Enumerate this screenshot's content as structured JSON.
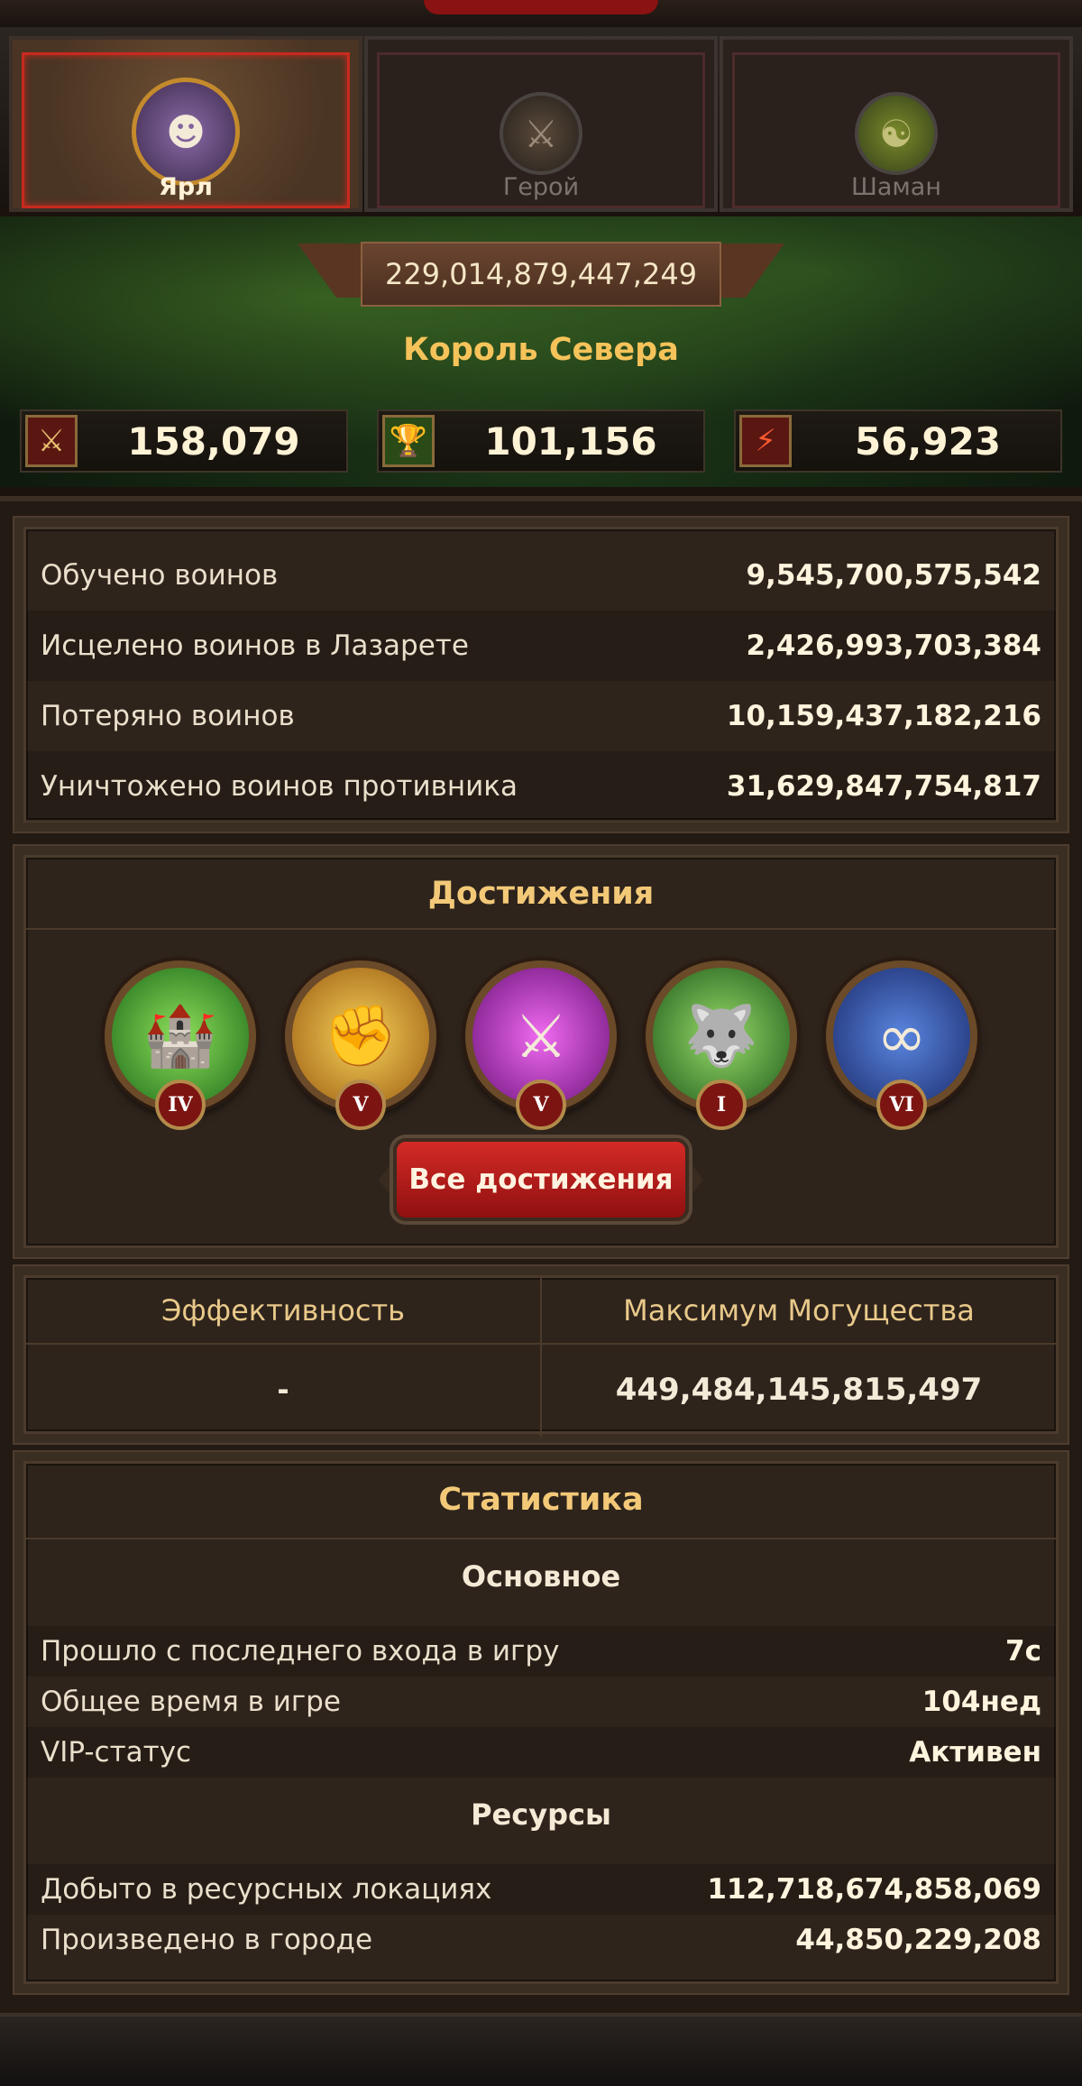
{
  "tabs": [
    {
      "label": "Ярл",
      "active": true,
      "icon": "hooded-jarl-avatar-icon"
    },
    {
      "label": "Герой",
      "active": false,
      "icon": "warrior-hero-avatar-icon"
    },
    {
      "label": "Шаман",
      "active": false,
      "icon": "shaman-avatar-icon"
    }
  ],
  "profile": {
    "power": "229,014,879,447,249",
    "title": "Король Севера",
    "stats": [
      {
        "icon": "crossed-swords-icon",
        "value": "158,079"
      },
      {
        "icon": "trophy-icon",
        "value": "101,156"
      },
      {
        "icon": "broken-shield-icon",
        "value": "56,923"
      }
    ]
  },
  "warriors": [
    {
      "label": "Обучено воинов",
      "value": "9,545,700,575,542"
    },
    {
      "label": "Исцелено воинов в Лазарете",
      "value": "2,426,993,703,384"
    },
    {
      "label": "Потеряно воинов",
      "value": "10,159,437,182,216"
    },
    {
      "label": "Уничтожено воинов противника",
      "value": "31,629,847,754,817"
    }
  ],
  "achievements": {
    "title": "Достижения",
    "items": [
      {
        "icon": "hand-building-tower-icon",
        "rank": "IV"
      },
      {
        "icon": "golden-fist-icon",
        "rank": "V"
      },
      {
        "icon": "helmet-crossed-weapons-icon",
        "rank": "V"
      },
      {
        "icon": "silver-wolf-head-icon",
        "rank": "I"
      },
      {
        "icon": "golden-rings-icon",
        "rank": "VI"
      }
    ],
    "button": "Все достижения"
  },
  "efficiency": {
    "left_header": "Эффективность",
    "right_header": "Максимум Могущества",
    "left_value": "-",
    "right_value": "449,484,145,815,497"
  },
  "statistics": {
    "title": "Статистика",
    "basic_title": "Основное",
    "basic": [
      {
        "label": "Прошло с последнего входа в игру",
        "value": "7с"
      },
      {
        "label": "Общее время в игре",
        "value": "104нед"
      },
      {
        "label": "VIP-статус",
        "value": "Активен"
      }
    ],
    "resources_title": "Ресурсы",
    "resources": [
      {
        "label": "Добыто в ресурсных локациях",
        "value": "112,718,674,858,069"
      },
      {
        "label": "Произведено в городе",
        "value": "44,850,229,208"
      }
    ]
  },
  "colors": {
    "accent_gold": "#f3c978",
    "button_red": "#c91f1c",
    "active_tab_border": "#c72a1e"
  }
}
